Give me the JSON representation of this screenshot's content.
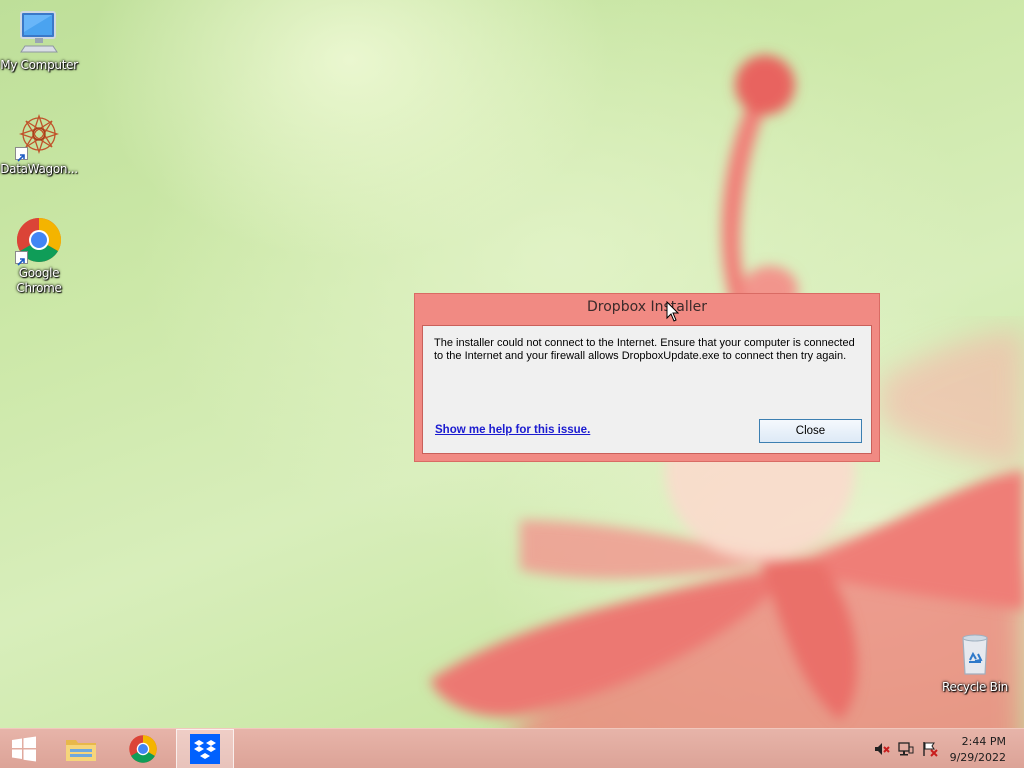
{
  "desktop": {
    "icons": [
      {
        "label": "My Computer"
      },
      {
        "label": "DataWagon..."
      },
      {
        "label": "Google\nChrome"
      },
      {
        "label": "Recycle Bin"
      }
    ]
  },
  "dialog": {
    "title": "Dropbox Installer",
    "message": "The installer could not connect to the Internet. Ensure that your computer is connected to the Internet and your firewall allows DropboxUpdate.exe to connect then try again.",
    "help_link": "Show me help for this issue.",
    "close_label": "Close"
  },
  "taskbar": {
    "buttons": [
      {
        "icon": "windows-start-icon"
      },
      {
        "icon": "file-explorer-icon"
      },
      {
        "icon": "chrome-icon"
      },
      {
        "icon": "dropbox-icon",
        "active": true
      }
    ],
    "tray": [
      {
        "icon": "speaker-muted-icon"
      },
      {
        "icon": "network-icon"
      },
      {
        "icon": "action-center-flag-icon"
      }
    ],
    "time": "2:44 PM",
    "date": "9/29/2022"
  },
  "colors": {
    "dialog_frame": "#f18a83",
    "taskbar": "#e0a99d",
    "link": "#1b1bd0",
    "button_border": "#3c7fb1",
    "dropbox_blue": "#0061fe"
  }
}
